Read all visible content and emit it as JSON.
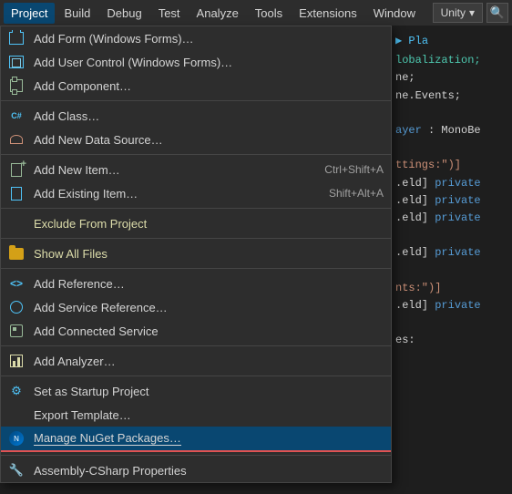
{
  "menubar": {
    "items": [
      {
        "label": "Project",
        "active": true
      },
      {
        "label": "Build",
        "active": false
      },
      {
        "label": "Debug",
        "active": false
      },
      {
        "label": "Test",
        "active": false
      },
      {
        "label": "Analyze",
        "active": false
      },
      {
        "label": "Tools",
        "active": false
      },
      {
        "label": "Extensions",
        "active": false
      },
      {
        "label": "Window",
        "active": false
      }
    ]
  },
  "header_right": {
    "unity_label": "Unity",
    "chevron": "▾",
    "search_icon": "🔍"
  },
  "toolbar": {
    "play_label": "▶ Pla"
  },
  "dropdown": {
    "items": [
      {
        "id": "add-form",
        "label": "Add Form (Windows Forms)…",
        "icon": "form",
        "shortcut": ""
      },
      {
        "id": "add-user-control",
        "label": "Add User Control (Windows Forms)…",
        "icon": "user-control",
        "shortcut": ""
      },
      {
        "id": "add-component",
        "label": "Add Component…",
        "icon": "component",
        "shortcut": ""
      },
      {
        "id": "separator1",
        "type": "separator"
      },
      {
        "id": "add-class",
        "label": "Add Class…",
        "icon": "class",
        "shortcut": ""
      },
      {
        "id": "add-data-source",
        "label": "Add New Data Source…",
        "icon": "data-source",
        "shortcut": ""
      },
      {
        "id": "separator2",
        "type": "separator"
      },
      {
        "id": "add-new-item",
        "label": "Add New Item…",
        "icon": "new-item",
        "shortcut": "Ctrl+Shift+A"
      },
      {
        "id": "add-existing-item",
        "label": "Add Existing Item…",
        "icon": "existing-item",
        "shortcut": "Shift+Alt+A"
      },
      {
        "id": "separator3",
        "type": "separator"
      },
      {
        "id": "exclude-from-project",
        "label": "Exclude From Project",
        "icon": "",
        "shortcut": "",
        "color": "yellow"
      },
      {
        "id": "separator4",
        "type": "separator"
      },
      {
        "id": "show-all-files",
        "label": "Show All Files",
        "icon": "folder",
        "shortcut": "",
        "color": "yellow"
      },
      {
        "id": "separator5",
        "type": "separator"
      },
      {
        "id": "add-reference",
        "label": "Add Reference…",
        "icon": "ref",
        "shortcut": ""
      },
      {
        "id": "add-service-reference",
        "label": "Add Service Reference…",
        "icon": "service",
        "shortcut": ""
      },
      {
        "id": "add-connected-service",
        "label": "Add Connected Service",
        "icon": "connected",
        "shortcut": ""
      },
      {
        "id": "separator6",
        "type": "separator"
      },
      {
        "id": "add-analyzer",
        "label": "Add Analyzer…",
        "icon": "analyzer",
        "shortcut": ""
      },
      {
        "id": "separator7",
        "type": "separator"
      },
      {
        "id": "set-startup",
        "label": "Set as Startup Project",
        "icon": "startup",
        "shortcut": ""
      },
      {
        "id": "export-template",
        "label": "Export Template…",
        "icon": "",
        "shortcut": ""
      },
      {
        "id": "manage-nuget",
        "label": "Manage NuGet Packages…",
        "icon": "nuget",
        "shortcut": "",
        "underline": true
      },
      {
        "id": "separator8",
        "type": "separator"
      },
      {
        "id": "assembly-properties",
        "label": "Assembly-CSharp Properties",
        "icon": "assembly",
        "shortcut": ""
      }
    ]
  },
  "code_lines": [
    "to Unity ▾",
    "",
    "▶ Pla",
    "lobalization;",
    "ne;",
    "ne.Events;",
    "",
    "ayer : MonoBe",
    "",
    "ttings:\")]",
    ".eld] private",
    ".eld] private",
    ".eld] private",
    "",
    ".eld] private",
    "",
    "nts:\")]",
    ".eld] private",
    "",
    "es:"
  ]
}
